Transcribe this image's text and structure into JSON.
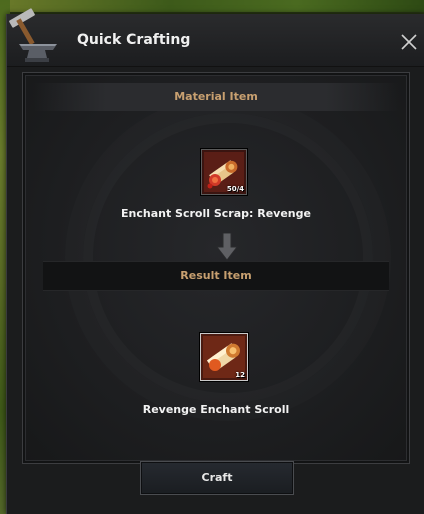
{
  "window": {
    "title": "Quick Crafting",
    "icon": "anvil-icon"
  },
  "material_section": {
    "header": "Material Item",
    "item": {
      "name": "Enchant Scroll Scrap: Revenge",
      "count": "50/4",
      "icon": "scroll-scrap-icon"
    }
  },
  "result_section": {
    "header": "Result Item",
    "item": {
      "name": "Revenge Enchant Scroll",
      "count": "12",
      "icon": "enchant-scroll-icon"
    }
  },
  "actions": {
    "craft_label": "Craft"
  },
  "colors": {
    "header_text": "#c8a070",
    "window_bg": "#1b1c1d",
    "item_border_highlight": "#c9c9c9"
  }
}
